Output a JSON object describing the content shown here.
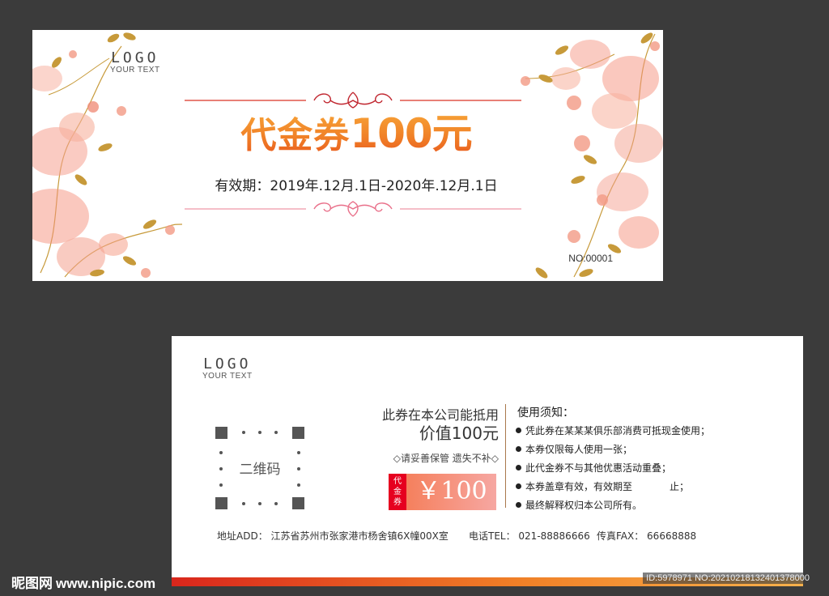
{
  "front": {
    "logo_main": "LOGO",
    "logo_sub": "YOUR TEXT",
    "title_prefix": "代金券",
    "title_amount": "100元",
    "validity": "有效期：2019年.12月.1日-2020年.12月.1日",
    "serial": "NO:00001"
  },
  "back": {
    "logo_main": "LOGO",
    "logo_sub": "YOUR TEXT",
    "qr_label": "二维码",
    "usage_line1": "此券在本公司能抵用",
    "usage_line2": "价值100元",
    "keep_note": "◇请妥善保管 遗失不补◇",
    "price_tag": [
      "代",
      "金",
      "券"
    ],
    "price_value": "￥100",
    "notes_title": "使用须知：",
    "notes": [
      "凭此券在某某某俱乐部消费可抵现金使用；",
      "本券仅限每人使用一张；",
      "此代金券不与其他优惠活动重叠；",
      "本券盖章有效，有效期至",
      "最终解释权归本公司所有。"
    ],
    "notes_4_suffix": "止；",
    "address": "地址ADD：  江苏省苏州市张家港市杨舍镇6X幢00X室",
    "tel": "电话TEL：  021-88886666",
    "fax": "传真FAX：  66668888"
  },
  "watermark": {
    "site": "昵图网",
    "url": "www.nipic.com",
    "id_text": "ID:5978971 NO:20210218132401378000"
  },
  "colors": {
    "background": "#3b3b3b",
    "title_orange": "#f08027",
    "price_red": "#e6001f",
    "divider_brown": "#a9784c"
  }
}
